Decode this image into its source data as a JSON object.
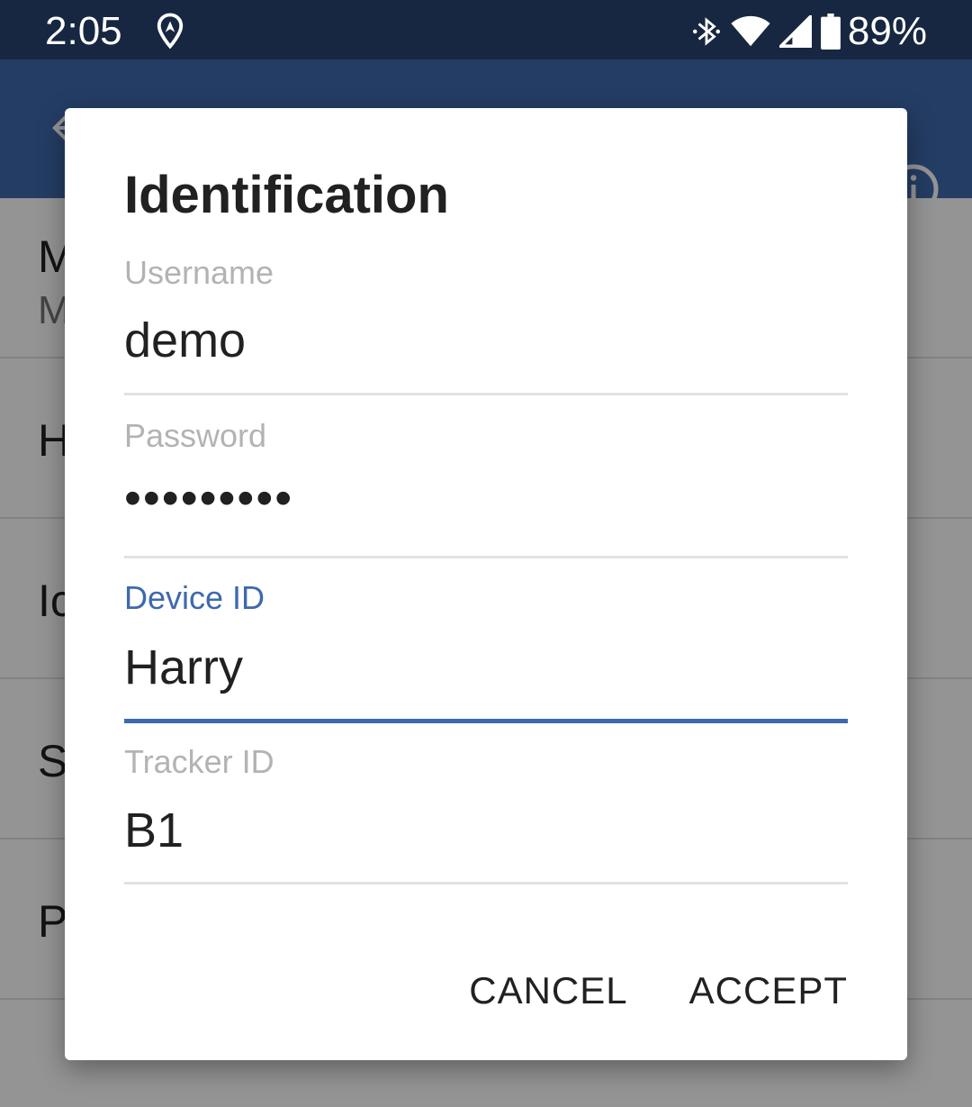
{
  "status_bar": {
    "time": "2:05",
    "battery": "89%",
    "icons": [
      "location-icon",
      "bluetooth-icon",
      "wifi-icon",
      "cell-signal-icon",
      "battery-icon"
    ]
  },
  "app_bar": {
    "color": "#3f69ad",
    "icons": [
      "back-arrow-icon",
      "forward-icon",
      "info-icon"
    ]
  },
  "list": {
    "items": [
      {
        "title": "M",
        "subtitle": "M"
      },
      {
        "title": "H"
      },
      {
        "title": "Ic"
      },
      {
        "title": "S"
      },
      {
        "title": "P"
      }
    ]
  },
  "dialog": {
    "title": "Identification",
    "username": {
      "label": "Username",
      "value": "demo"
    },
    "password": {
      "label": "Password",
      "value": "•••••••••"
    },
    "device_id": {
      "label": "Device ID",
      "value": "Harry"
    },
    "tracker_id": {
      "label": "Tracker ID",
      "value": "B1"
    },
    "cancel_label": "CANCEL",
    "accept_label": "ACCEPT",
    "accent_color": "#3f69ad"
  }
}
